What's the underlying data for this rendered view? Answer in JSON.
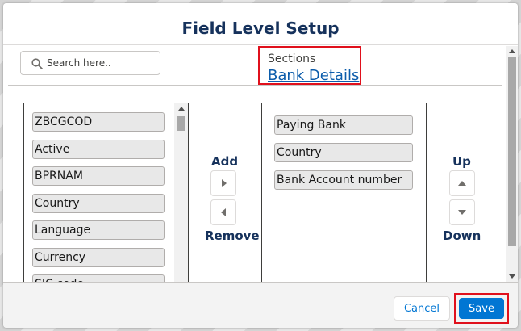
{
  "modal": {
    "title": "Field Level Setup"
  },
  "search": {
    "placeholder": "Search here.."
  },
  "sections": {
    "label": "Sections",
    "selected": "Bank Details"
  },
  "available_fields": {
    "items": [
      "ZBCGCOD",
      "Active",
      "BPRNAM",
      "Country",
      "Language",
      "Currency",
      "SIC code"
    ]
  },
  "selected_fields": {
    "items": [
      "Paying Bank",
      "Country",
      "Bank Account number"
    ]
  },
  "controls": {
    "add_label": "Add",
    "remove_label": "Remove",
    "up_label": "Up",
    "down_label": "Down"
  },
  "footer": {
    "cancel_label": "Cancel",
    "save_label": "Save"
  },
  "colors": {
    "title": "#16325c",
    "link": "#0b5cab",
    "save_button": "#0176d3",
    "highlight_outline": "#e0101c"
  }
}
